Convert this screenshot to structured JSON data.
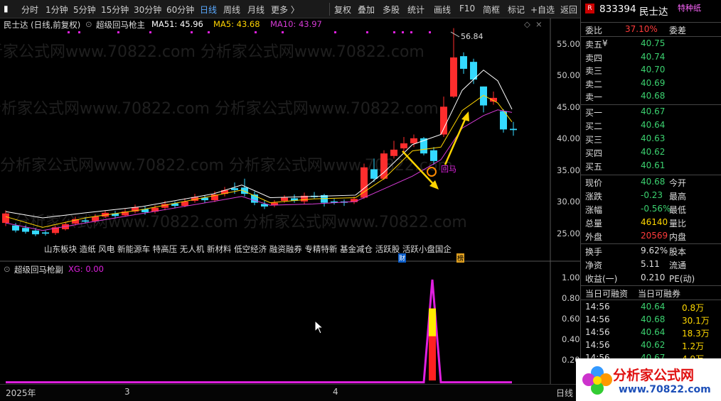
{
  "toolbar": {
    "items": [
      "分时",
      "1分钟",
      "5分钟",
      "15分钟",
      "30分钟",
      "60分钟",
      "日线",
      "周线",
      "月线",
      "更多 〉"
    ],
    "tools": [
      "复权",
      "叠加",
      "多股",
      "统计",
      "画线",
      "F10",
      "简框",
      "标记",
      "+自选",
      "返回"
    ],
    "active": "日线"
  },
  "main_header": {
    "stock": "民士达 (日线,前复权)",
    "indicator": "超级回马枪主",
    "ma51": "MA51: 45.96",
    "ma5": "MA5: 43.68",
    "ma10": "MA10: 43.97"
  },
  "price_axis": [
    "55.00",
    "50.00",
    "45.00",
    "40.00",
    "35.00",
    "30.00",
    "25.00"
  ],
  "peak_label": "56.84",
  "signal_label": "回马",
  "markers": [
    "财",
    "榜"
  ],
  "concepts": "山东板块 造纸 风电 新能源车 特高压 无人机 新材料 低空经济  融资融券 专精特新 基金减仓 活跃股 活跃小盘国企",
  "sub_header": {
    "indicator": "超级回马枪副",
    "xg": "XG: 0.00"
  },
  "sub_axis": [
    "1.00",
    "0.80",
    "0.60",
    "0.40",
    "0.20"
  ],
  "date_axis": {
    "start": "2025年",
    "m3": "3",
    "m4": "4",
    "right": "日线"
  },
  "quote": {
    "code": "833394",
    "name": "民士达",
    "badge": "特种纸",
    "r": "R",
    "webi_label": "委比",
    "webi": "37.10%",
    "weicha_label": "委差",
    "asks": [
      {
        "l": "卖五",
        "p": "40.75",
        "y": "¥"
      },
      {
        "l": "卖四",
        "p": "40.74"
      },
      {
        "l": "卖三",
        "p": "40.70"
      },
      {
        "l": "卖二",
        "p": "40.69"
      },
      {
        "l": "卖一",
        "p": "40.68"
      }
    ],
    "bids": [
      {
        "l": "买一",
        "p": "40.67"
      },
      {
        "l": "买二",
        "p": "40.64"
      },
      {
        "l": "买三",
        "p": "40.63"
      },
      {
        "l": "买四",
        "p": "40.62"
      },
      {
        "l": "买五",
        "p": "40.61"
      }
    ],
    "stats": [
      {
        "a": "现价",
        "v": "40.68",
        "b": "今开",
        "c": "green"
      },
      {
        "a": "涨跌",
        "v": "-0.23",
        "b": "最高",
        "c": "green"
      },
      {
        "a": "涨幅",
        "v": "-0.56%",
        "b": "最低",
        "c": "green"
      },
      {
        "a": "总量",
        "v": "46140",
        "b": "量比",
        "c": "yel"
      },
      {
        "a": "外盘",
        "v": "20569",
        "b": "内盘",
        "c": "red"
      }
    ],
    "stats2": [
      {
        "a": "换手",
        "v": "9.62%",
        "b": "股本"
      },
      {
        "a": "净资",
        "v": "5.11",
        "b": "流通"
      },
      {
        "a": "收益(一)",
        "v": "0.210",
        "b": "PE(动)"
      }
    ],
    "margin": [
      "当日可融资",
      "当日可融券"
    ],
    "ticks": [
      {
        "t": "14:56",
        "p": "40.64",
        "v": "0.8万"
      },
      {
        "t": "14:56",
        "p": "40.68",
        "v": "30.1万"
      },
      {
        "t": "14:56",
        "p": "40.64",
        "v": "18.3万"
      },
      {
        "t": "14:56",
        "p": "40.62",
        "v": "1.2万"
      },
      {
        "t": "14:56",
        "p": "40.67",
        "v": "4.9万"
      }
    ]
  },
  "watermark": "分析家公式网www.70822.com",
  "logo": {
    "title": "分析家公式网",
    "url": "www.70822.com"
  },
  "colors": {
    "up": "#ff2d2d",
    "down": "#34d9ff",
    "ma51": "#ffffff",
    "ma5": "#ffd400",
    "ma10": "#d63bd6",
    "signal": "#e020e0"
  }
}
